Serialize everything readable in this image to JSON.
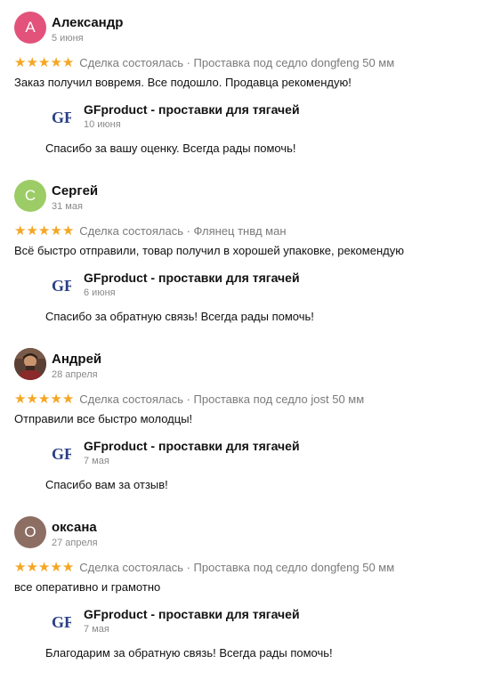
{
  "colors": {
    "star": "#f5a623",
    "avatar_a": "#e2527a",
    "avatar_c": "#9ccc65",
    "avatar_o": "#8d6e63",
    "logo": "#2a3f86"
  },
  "reviews": [
    {
      "initial": "А",
      "name": "Александр",
      "date": "5 июня",
      "rating": 5,
      "deal": "Сделка состоялась · Проставка под седло dongfeng 50 мм",
      "text": "Заказ получил вовремя. Все подошло. Продавца рекомендую!",
      "reply": {
        "seller": "GFproduct - проставки для тягачей",
        "logo_text": "GF",
        "date": "10 июня",
        "text": "Спасибо за вашу оценку. Всегда рады помочь!"
      }
    },
    {
      "initial": "С",
      "name": "Сергей",
      "date": "31 мая",
      "rating": 5,
      "deal": "Сделка состоялась · Флянец тнвд ман",
      "text": "Всё быстро отправили, товар получил в хорошей упаковке, рекомендую",
      "reply": {
        "seller": "GFproduct - проставки для тягачей",
        "logo_text": "GF",
        "date": "6 июня",
        "text": "Спасибо за обратную связь! Всегда рады помочь!"
      }
    },
    {
      "initial": "",
      "name": "Андрей",
      "date": "28 апреля",
      "rating": 5,
      "deal": "Сделка состоялась · Проставка под седло jost 50 мм",
      "text": "Отправили все быстро молодцы!",
      "reply": {
        "seller": "GFproduct - проставки для тягачей",
        "logo_text": "GF",
        "date": "7 мая",
        "text": "Спасибо вам за отзыв!"
      }
    },
    {
      "initial": "О",
      "name": "оксана",
      "date": "27 апреля",
      "rating": 5,
      "deal": "Сделка состоялась · Проставка под седло dongfeng 50 мм",
      "text": "все оперативно и грамотно",
      "reply": {
        "seller": "GFproduct - проставки для тягачей",
        "logo_text": "GF",
        "date": "7 мая",
        "text": "Благодарим за обратную связь! Всегда рады помочь!"
      }
    }
  ]
}
